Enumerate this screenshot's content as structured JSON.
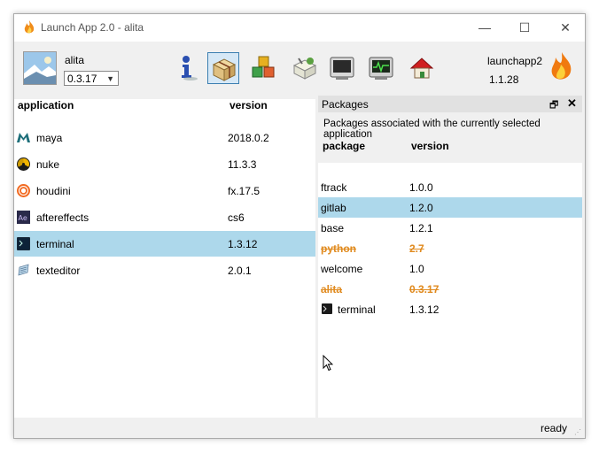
{
  "window": {
    "title": "Launch App 2.0 - alita",
    "minimize_glyph": "—",
    "maximize_glyph": "☐",
    "close_glyph": "✕"
  },
  "user": {
    "name": "alita",
    "selected_version": "0.3.17"
  },
  "toolbar": {
    "tools": [
      "info-icon",
      "package-icon",
      "cubes-icon",
      "settings-icon",
      "console-icon",
      "monitor-icon",
      "home-icon"
    ],
    "active_tool": "package-icon"
  },
  "launcher": {
    "name": "launchapp2",
    "version": "1.1.28"
  },
  "applications": {
    "header_application": "application",
    "header_version": "version",
    "rows": [
      {
        "name": "maya",
        "version": "2018.0.2",
        "icon": "maya-icon"
      },
      {
        "name": "nuke",
        "version": "11.3.3",
        "icon": "nuke-icon"
      },
      {
        "name": "houdini",
        "version": "fx.17.5",
        "icon": "houdini-icon"
      },
      {
        "name": "aftereffects",
        "version": "cs6",
        "icon": "aftereffects-icon"
      },
      {
        "name": "terminal",
        "version": "1.3.12",
        "icon": "terminal-icon"
      },
      {
        "name": "texteditor",
        "version": "2.0.1",
        "icon": "texteditor-icon"
      }
    ],
    "selected": "terminal"
  },
  "packages": {
    "dock_title": "Packages",
    "float_glyph": "🗗",
    "close_glyph": "✕",
    "description": "Packages associated with the currently selected application",
    "header_package": "package",
    "header_version": "version",
    "rows": [
      {
        "name": "ftrack",
        "version": "1.0.0"
      },
      {
        "name": "gitlab",
        "version": "1.2.0"
      },
      {
        "name": "base",
        "version": "1.2.1"
      },
      {
        "name": "python",
        "version": "2.7"
      },
      {
        "name": "welcome",
        "version": "1.0"
      },
      {
        "name": "alita",
        "version": "0.3.17"
      },
      {
        "name": "terminal",
        "version": "1.3.12"
      }
    ],
    "selected": "gitlab",
    "struck": [
      "python",
      "alita"
    ]
  },
  "status": {
    "text": "ready"
  },
  "colors": {
    "selection": "#add8eb",
    "struck_package": "#e08a1e",
    "tool_active_border": "#3c7fb1"
  }
}
